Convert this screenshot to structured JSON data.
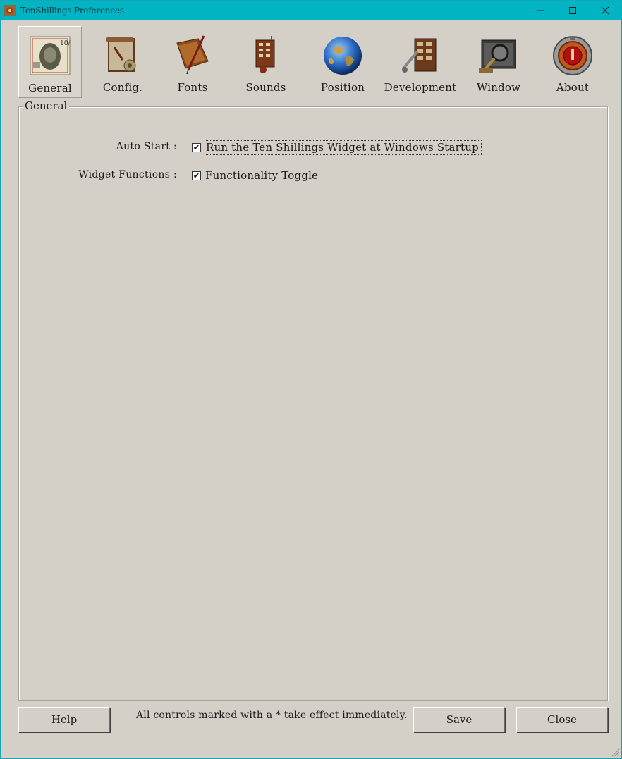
{
  "window": {
    "title": "TenShillings Preferences",
    "controls": {
      "minimize": "—",
      "maximize": "☐",
      "close": "✕"
    }
  },
  "tabs": [
    {
      "label": "General",
      "icon": "banknote-icon",
      "selected": true
    },
    {
      "label": "Config.",
      "icon": "config-scroll-icon",
      "selected": false
    },
    {
      "label": "Fonts",
      "icon": "book-quill-icon",
      "selected": false
    },
    {
      "label": "Sounds",
      "icon": "sound-machine-icon",
      "selected": false
    },
    {
      "label": "Position",
      "icon": "globe-icon",
      "selected": false
    },
    {
      "label": "Development",
      "icon": "development-tools-icon",
      "selected": false
    },
    {
      "label": "Window",
      "icon": "magnifier-window-icon",
      "selected": false
    },
    {
      "label": "About",
      "icon": "about-dial-icon",
      "selected": false
    }
  ],
  "general": {
    "legend": "General",
    "auto_start": {
      "label": "Auto Start :",
      "checkbox_text": "Run the Ten Shillings Widget at Windows Startup",
      "checked": true
    },
    "widget_functions": {
      "label": "Widget Functions :",
      "checkbox_text": "Functionality Toggle",
      "checked": true
    }
  },
  "footer": {
    "help": "Help",
    "note": "All controls marked with a * take effect immediately.",
    "save": "Save",
    "close": "Close"
  },
  "colors": {
    "titlebar": "#00b4c4",
    "background": "#d4d0c8"
  }
}
